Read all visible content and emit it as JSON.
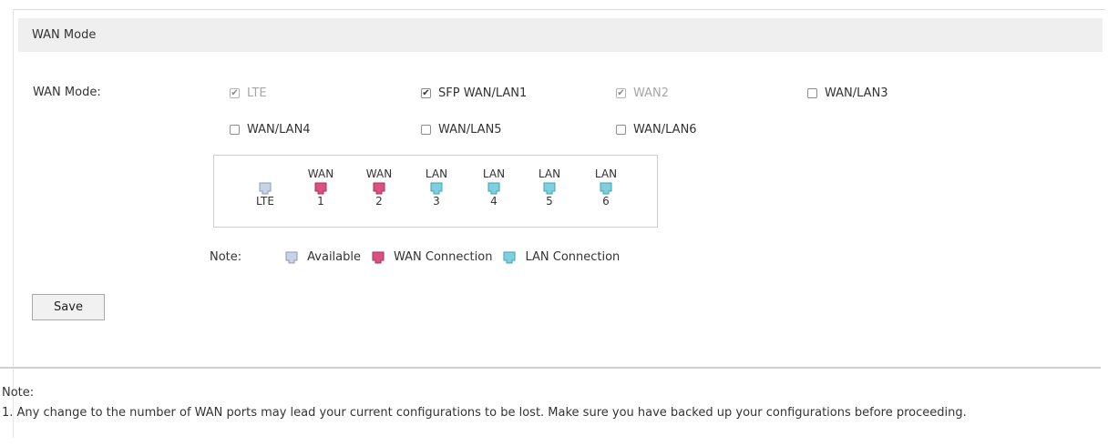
{
  "section": {
    "title": "WAN Mode"
  },
  "wan_mode": {
    "label": "WAN Mode:",
    "options": [
      {
        "label": "LTE",
        "checked": true,
        "disabled": true
      },
      {
        "label": "SFP WAN/LAN1",
        "checked": true,
        "disabled": false
      },
      {
        "label": "WAN2",
        "checked": true,
        "disabled": true
      },
      {
        "label": "WAN/LAN3",
        "checked": false,
        "disabled": false
      },
      {
        "label": "WAN/LAN4",
        "checked": false,
        "disabled": false
      },
      {
        "label": "WAN/LAN5",
        "checked": false,
        "disabled": false
      },
      {
        "label": "WAN/LAN6",
        "checked": false,
        "disabled": false
      }
    ]
  },
  "ports": [
    {
      "top_label": "",
      "bottom_label": "LTE",
      "status": "available"
    },
    {
      "top_label": "WAN",
      "bottom_label": "1",
      "status": "wan"
    },
    {
      "top_label": "WAN",
      "bottom_label": "2",
      "status": "wan"
    },
    {
      "top_label": "LAN",
      "bottom_label": "3",
      "status": "lan"
    },
    {
      "top_label": "LAN",
      "bottom_label": "4",
      "status": "lan"
    },
    {
      "top_label": "LAN",
      "bottom_label": "5",
      "status": "lan"
    },
    {
      "top_label": "LAN",
      "bottom_label": "6",
      "status": "lan"
    }
  ],
  "legend": {
    "label": "Note:",
    "items": [
      {
        "label": "Available",
        "status": "available"
      },
      {
        "label": "WAN Connection",
        "status": "wan"
      },
      {
        "label": "LAN Connection",
        "status": "lan"
      }
    ]
  },
  "colors": {
    "available": "#c9d3e6",
    "wan": "#d9517c",
    "lan": "#7ed0df"
  },
  "icons": {
    "checked": "check-mark",
    "port": "ethernet-port-icon"
  },
  "save_button": {
    "label": "Save"
  },
  "notes": {
    "title": "Note:",
    "lines": [
      "1. Any change to the number of WAN ports may lead your current configurations to be lost. Make sure you have backed up your configurations before proceeding."
    ]
  }
}
